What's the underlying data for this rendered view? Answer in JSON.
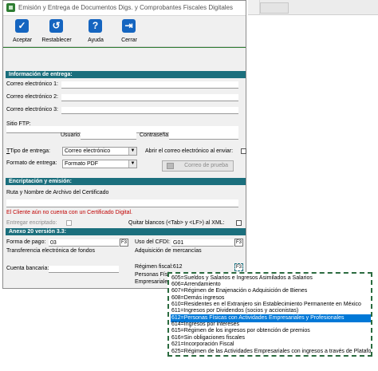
{
  "window": {
    "title": "Emisión y Entrega de Documentos Digs. y Comprobantes Fiscales Digitales"
  },
  "toolbar": {
    "aceptar": "Aceptar",
    "restablecer": "Restablecer",
    "ayuda": "Ayuda",
    "cerrar": "Cerrar"
  },
  "entrega": {
    "header": "Información de entrega:",
    "correo1": "Correo electrónico 1:",
    "correo2": "Correo electrónico 2:",
    "correo3": "Correo electrónico 3:",
    "sitio_ftp": "Sitio FTP:",
    "usuario": "Usuario:",
    "contrasena": "Contraseña:",
    "tipo_entrega": "Tipo de entrega:",
    "tipo_value": "Correo electrónico",
    "abrir_correo": "Abrir el correo electrónico al enviar:",
    "formato_entrega": "Formato de entrega:",
    "formato_value": "Formato PDF",
    "correo_prueba": "Correo de prueba"
  },
  "encriptacion": {
    "header": "Encriptación y emisión:",
    "ruta_label": "Ruta y Nombre de Archivo del Certificado",
    "warning": "El Cliente aún no cuenta con un Certificado Digital.",
    "entregar_encriptado": "Entregar encriptado:",
    "quitar_blancos": "Quitar blancos (<Tab> y <LF>) al XML:"
  },
  "anexo": {
    "header": "Anexo 20 versión 3.3:",
    "forma_pago_label": "Forma de pago:",
    "forma_pago_value": "03",
    "forma_pago_desc": "Transferencia electrónica de fondos",
    "uso_cfdi_label": "Uso del CFDI:",
    "uso_cfdi_value": "G01",
    "uso_cfdi_desc": "Adquisición de mercancías",
    "cuenta_bancaria": "Cuenta bancaria:",
    "regimen_label": "Régimen fiscal:",
    "regimen_value": "612",
    "personas_fisicas": "Personas Físicas",
    "empresariales": "Empresariales",
    "f3": "F3"
  },
  "dropdown": {
    "items": [
      "605=Sueldos y Salarios e Ingresos Asimilados a Salarios",
      "606=Arrendamiento",
      "607=Régimen de Enajenación o Adquisición de Bienes",
      "608=Demás ingresos",
      "610=Residentes en el Extranjero sin Establecimiento Permanente en México",
      "611=Ingresos por Dividendos (socios y accionistas)",
      "612=Personas Físicas con Actividades Empresariales y Profesionales",
      "614=Ingresos por intereses",
      "615=Régimen de los ingresos por obtención de premios",
      "616=Sin obligaciones fiscales",
      "621=Incorporación Fiscal",
      "625=Régimen de las Actividades Empresariales con ingresos a través de Plataformas"
    ],
    "selected_index": 6
  }
}
